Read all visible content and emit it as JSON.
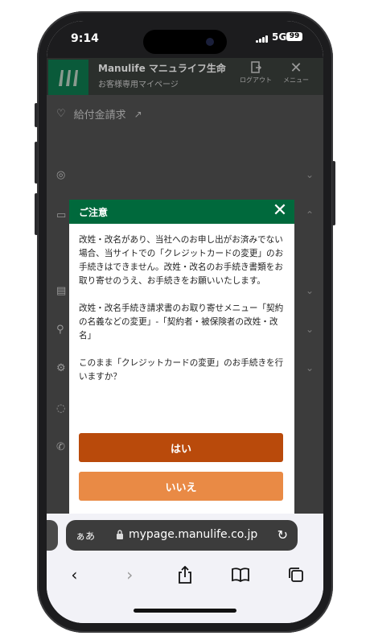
{
  "status_bar": {
    "time": "9:14",
    "network": "5G",
    "battery": "99"
  },
  "header": {
    "brand": "Manulife マニュライフ生命",
    "subtitle": "お客様専用マイページ",
    "logout_label": "ログアウト",
    "menu_label": "メニュー"
  },
  "background_menu": {
    "first_item": "給付金請求"
  },
  "modal": {
    "title": "ご注意",
    "paragraphs": [
      "改姓・改名があり、当社へのお申し出がお済みでない場合、当サイトでの「クレジットカードの変更」のお手続きはできません。改姓・改名のお手続き書類をお取り寄せのうえ、お手続きをお願いいたします。",
      "改姓・改名手続き請求書のお取り寄せメニュー「契約の名義などの変更」-「契約者・被保険者の改姓・改名」",
      "このまま「クレジットカードの変更」のお手続きを行いますか？"
    ],
    "yes_label": "はい",
    "no_label": "いいえ"
  },
  "browser": {
    "text_size_label": "ぁあ",
    "url": "mypage.manulife.co.jp"
  },
  "colors": {
    "brand_green": "#00693c",
    "yes_button": "#b94a0b",
    "no_button": "#e98a45"
  }
}
